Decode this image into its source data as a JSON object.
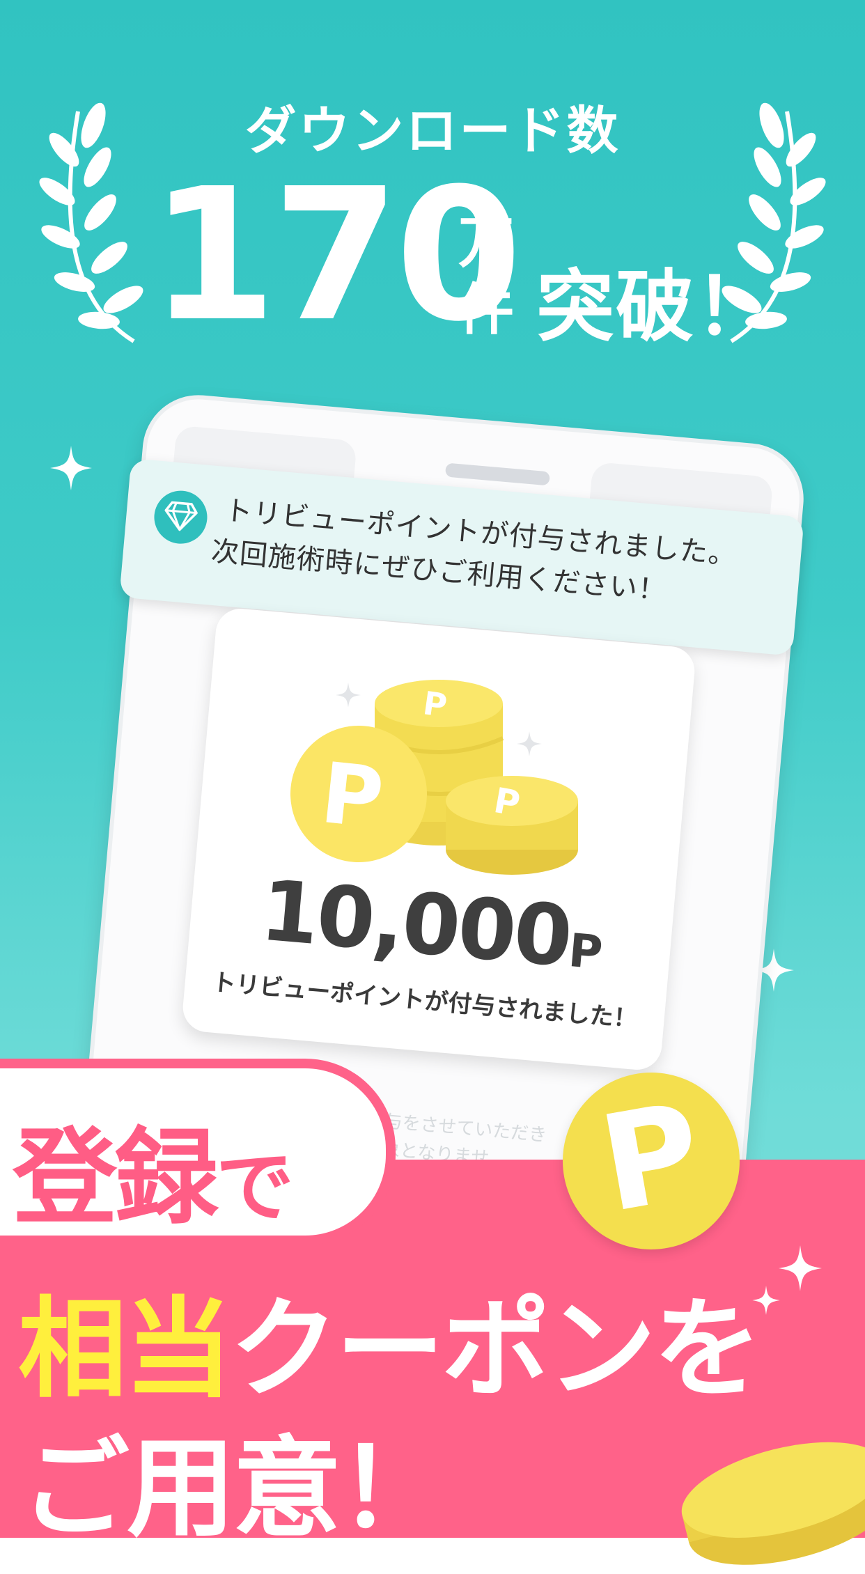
{
  "header": {
    "headline": "ダウンロード数",
    "number": "170",
    "unit_top": "万",
    "unit_bottom": "件",
    "suffix": "突破！"
  },
  "notification": {
    "icon": "diamond-icon",
    "line1": "トリビューポイントが付与されました。",
    "line2": "次回施術時にぜひご利用ください！"
  },
  "card": {
    "amount": "10,000",
    "unit": "P",
    "caption": "トリビューポイントが付与されました！"
  },
  "faint_text": {
    "line1": "イント付与をさせていただき",
    "line2": "還元の対象となりませ"
  },
  "promo": {
    "pill": "登録",
    "pill_suffix": "で",
    "highlight": "相当",
    "line1_rest": "クーポンを",
    "line2": "ご用意！"
  },
  "coin_label": "P",
  "colors": {
    "teal": "#31c3c1",
    "pink": "#ff6289",
    "yellow_text": "#ffef3d",
    "coin": "#f4df4e"
  }
}
